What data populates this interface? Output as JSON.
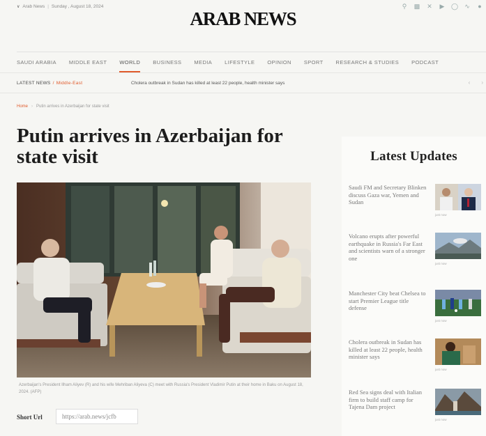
{
  "header": {
    "edition": "Arab News",
    "date": "Sunday , August 18, 2024",
    "logo": "ARAB NEWS",
    "social_icons": [
      "search-icon",
      "facebook-icon",
      "x-icon",
      "youtube-icon",
      "instagram-icon",
      "rss-icon",
      "globe-icon"
    ]
  },
  "nav": {
    "items": [
      "SAUDI ARABIA",
      "MIDDLE EAST",
      "WORLD",
      "BUSINESS",
      "MEDIA",
      "LIFESTYLE",
      "OPINION",
      "SPORT",
      "RESEARCH & STUDIES",
      "PODCAST"
    ],
    "active": "WORLD"
  },
  "ticker": {
    "label": "LATEST NEWS",
    "category": "Middle-East",
    "headline": "Cholera outbreak in Sudan has killed at least 22 people, health minister says"
  },
  "breadcrumb": {
    "home": "Home",
    "current": "Putin arrives in Azerbaijan for state visit"
  },
  "article": {
    "title": "Putin arrives in Azerbaijan for state visit",
    "caption": "Azerbaijan's President Ilham Aliyev (R) and his wife Mehriban Aliyeva (C) meet with Russia's President Vladimir Putin at their home in Baku on August 18, 2024. (AFP)",
    "short_url_label": "Short Url",
    "short_url": "https://arab.news/jcfb"
  },
  "sidebar": {
    "title": "Latest Updates",
    "stories": [
      {
        "headline": "Saudi FM and Secretary Blinken discuss Gaza war, Yemen and Sudan",
        "date": "just now"
      },
      {
        "headline": "Volcano erupts after powerful earthquake in Russia's Far East and scientists warn of a stronger one",
        "date": "just now"
      },
      {
        "headline": "Manchester City beat Chelsea to start Premier League title defense",
        "date": "just now"
      },
      {
        "headline": "Cholera outbreak in Sudan has killed at least 22 people, health minister says",
        "date": "just now"
      },
      {
        "headline": "Red Sea signs deal with Italian firm to build staff camp for Tajena Dam project",
        "date": "just now"
      }
    ]
  },
  "colors": {
    "accent": "#e05a2b",
    "background": "#f6f6f3"
  }
}
